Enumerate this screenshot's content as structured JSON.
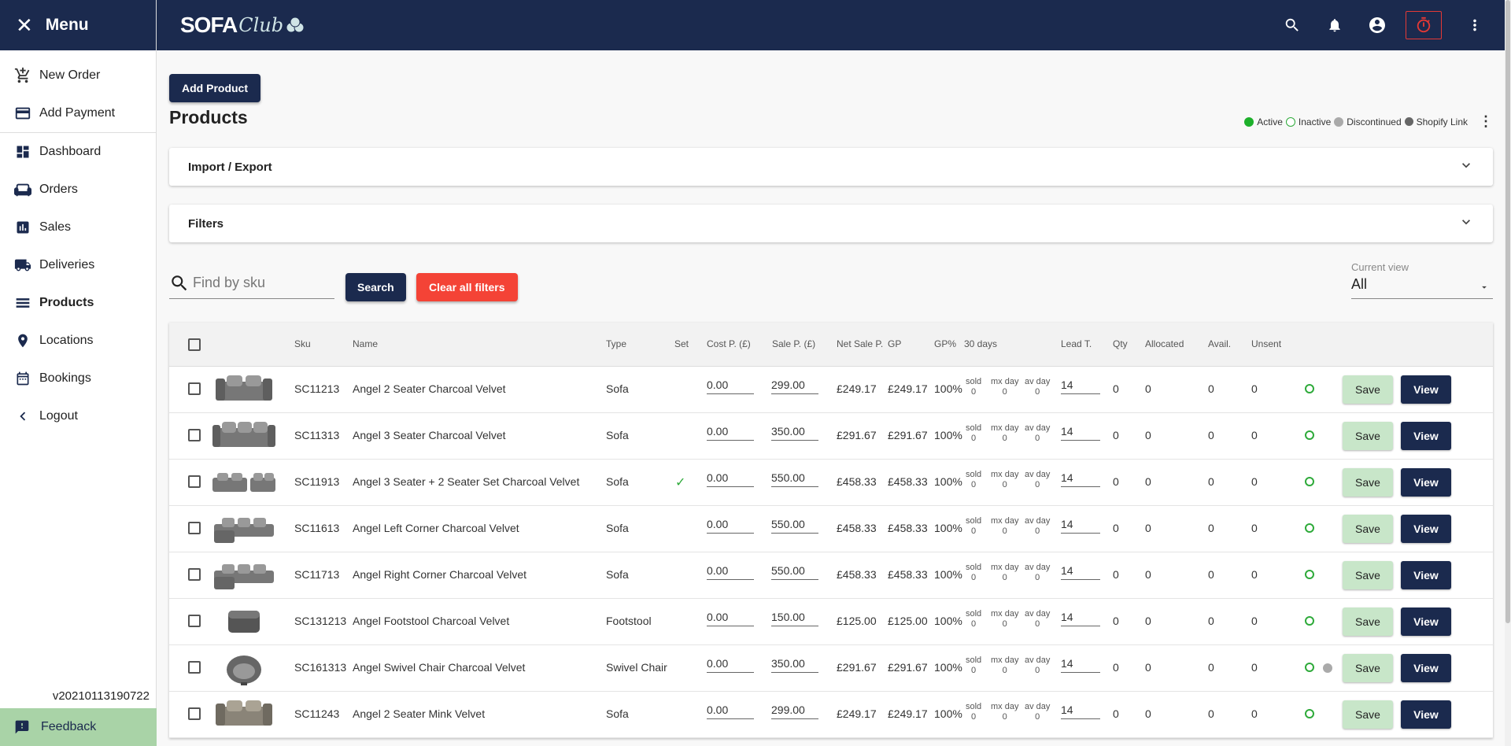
{
  "sidebar": {
    "title": "Menu",
    "items": [
      {
        "label": "New Order",
        "icon": "cart-plus-icon"
      },
      {
        "label": "Add Payment",
        "icon": "credit-card-icon"
      },
      {
        "label": "Dashboard",
        "icon": "dashboard-icon"
      },
      {
        "label": "Orders",
        "icon": "sofa-icon"
      },
      {
        "label": "Sales",
        "icon": "bar-chart-icon"
      },
      {
        "label": "Deliveries",
        "icon": "truck-icon"
      },
      {
        "label": "Products",
        "icon": "list-icon"
      },
      {
        "label": "Locations",
        "icon": "location-pin-icon"
      },
      {
        "label": "Bookings",
        "icon": "calendar-icon"
      },
      {
        "label": "Logout",
        "icon": "chevron-left-icon"
      }
    ],
    "version": "v20210113190722",
    "feedback": "Feedback"
  },
  "topbar": {
    "logo_sofa": "SOFA",
    "logo_club": "Club",
    "icons": [
      "search-icon",
      "bell-icon",
      "account-icon",
      "timer-icon",
      "more-vert-icon"
    ]
  },
  "main": {
    "add_product": "Add Product",
    "title": "Products",
    "legend": {
      "active": "Active",
      "inactive": "Inactive",
      "discontinued": "Discontinued",
      "shopify": "Shopify Link",
      "colors": {
        "active": "#1db02b",
        "inactive": "#2eaa3a",
        "discontinued": "#aaaaaa",
        "shopify": "#666666"
      }
    },
    "import_export": "Import / Export",
    "filters": "Filters",
    "search_placeholder": "Find by sku",
    "search_button": "Search",
    "clear_button": "Clear all filters",
    "current_view_label": "Current view",
    "current_view_value": "All"
  },
  "table": {
    "headers": {
      "sku": "Sku",
      "name": "Name",
      "type": "Type",
      "set": "Set",
      "cost": "Cost P. (£)",
      "sale": "Sale P. (£)",
      "net": "Net Sale P.",
      "gp": "GP",
      "gpp": "GP%",
      "days": "30 days",
      "lead": "Lead T.",
      "qty": "Qty",
      "allocated": "Allocated",
      "avail": "Avail.",
      "unsent": "Unsent"
    },
    "stat_labels": {
      "sold": "sold",
      "mx": "mx day",
      "av": "av day"
    },
    "save_label": "Save",
    "view_label": "View",
    "rows": [
      {
        "sku": "SC11213",
        "name": "Angel 2 Seater Charcoal Velvet",
        "type": "Sofa",
        "set": "",
        "cost": "0.00",
        "sale": "299.00",
        "net": "£249.17",
        "gp": "£249.17",
        "gpp": "100%",
        "sold": "0",
        "mx": "0",
        "av": "0",
        "lead": "14",
        "qty": "0",
        "allocated": "0",
        "avail": "0",
        "unsent": "0",
        "discontinued": false,
        "img": "2seat"
      },
      {
        "sku": "SC11313",
        "name": "Angel 3 Seater Charcoal Velvet",
        "type": "Sofa",
        "set": "",
        "cost": "0.00",
        "sale": "350.00",
        "net": "£291.67",
        "gp": "£291.67",
        "gpp": "100%",
        "sold": "0",
        "mx": "0",
        "av": "0",
        "lead": "14",
        "qty": "0",
        "allocated": "0",
        "avail": "0",
        "unsent": "0",
        "discontinued": false,
        "img": "3seat"
      },
      {
        "sku": "SC11913",
        "name": "Angel 3 Seater + 2 Seater Set Charcoal Velvet",
        "type": "Sofa",
        "set": "✓",
        "cost": "0.00",
        "sale": "550.00",
        "net": "£458.33",
        "gp": "£458.33",
        "gpp": "100%",
        "sold": "0",
        "mx": "0",
        "av": "0",
        "lead": "14",
        "qty": "0",
        "allocated": "0",
        "avail": "0",
        "unsent": "0",
        "discontinued": false,
        "img": "set"
      },
      {
        "sku": "SC11613",
        "name": "Angel Left Corner Charcoal Velvet",
        "type": "Sofa",
        "set": "",
        "cost": "0.00",
        "sale": "550.00",
        "net": "£458.33",
        "gp": "£458.33",
        "gpp": "100%",
        "sold": "0",
        "mx": "0",
        "av": "0",
        "lead": "14",
        "qty": "0",
        "allocated": "0",
        "avail": "0",
        "unsent": "0",
        "discontinued": false,
        "img": "corner"
      },
      {
        "sku": "SC11713",
        "name": "Angel Right Corner Charcoal Velvet",
        "type": "Sofa",
        "set": "",
        "cost": "0.00",
        "sale": "550.00",
        "net": "£458.33",
        "gp": "£458.33",
        "gpp": "100%",
        "sold": "0",
        "mx": "0",
        "av": "0",
        "lead": "14",
        "qty": "0",
        "allocated": "0",
        "avail": "0",
        "unsent": "0",
        "discontinued": false,
        "img": "corner"
      },
      {
        "sku": "SC131213",
        "name": "Angel Footstool Charcoal Velvet",
        "type": "Footstool",
        "set": "",
        "cost": "0.00",
        "sale": "150.00",
        "net": "£125.00",
        "gp": "£125.00",
        "gpp": "100%",
        "sold": "0",
        "mx": "0",
        "av": "0",
        "lead": "14",
        "qty": "0",
        "allocated": "0",
        "avail": "0",
        "unsent": "0",
        "discontinued": false,
        "img": "stool"
      },
      {
        "sku": "SC161313",
        "name": "Angel Swivel Chair Charcoal Velvet",
        "type": "Swivel Chair",
        "set": "",
        "cost": "0.00",
        "sale": "350.00",
        "net": "£291.67",
        "gp": "£291.67",
        "gpp": "100%",
        "sold": "0",
        "mx": "0",
        "av": "0",
        "lead": "14",
        "qty": "0",
        "allocated": "0",
        "avail": "0",
        "unsent": "0",
        "discontinued": true,
        "img": "chair"
      },
      {
        "sku": "SC11243",
        "name": "Angel 2 Seater Mink Velvet",
        "type": "Sofa",
        "set": "",
        "cost": "0.00",
        "sale": "299.00",
        "net": "£249.17",
        "gp": "£249.17",
        "gpp": "100%",
        "sold": "0",
        "mx": "0",
        "av": "0",
        "lead": "14",
        "qty": "0",
        "allocated": "0",
        "avail": "0",
        "unsent": "0",
        "discontinued": false,
        "img": "2seat-mink"
      }
    ]
  }
}
